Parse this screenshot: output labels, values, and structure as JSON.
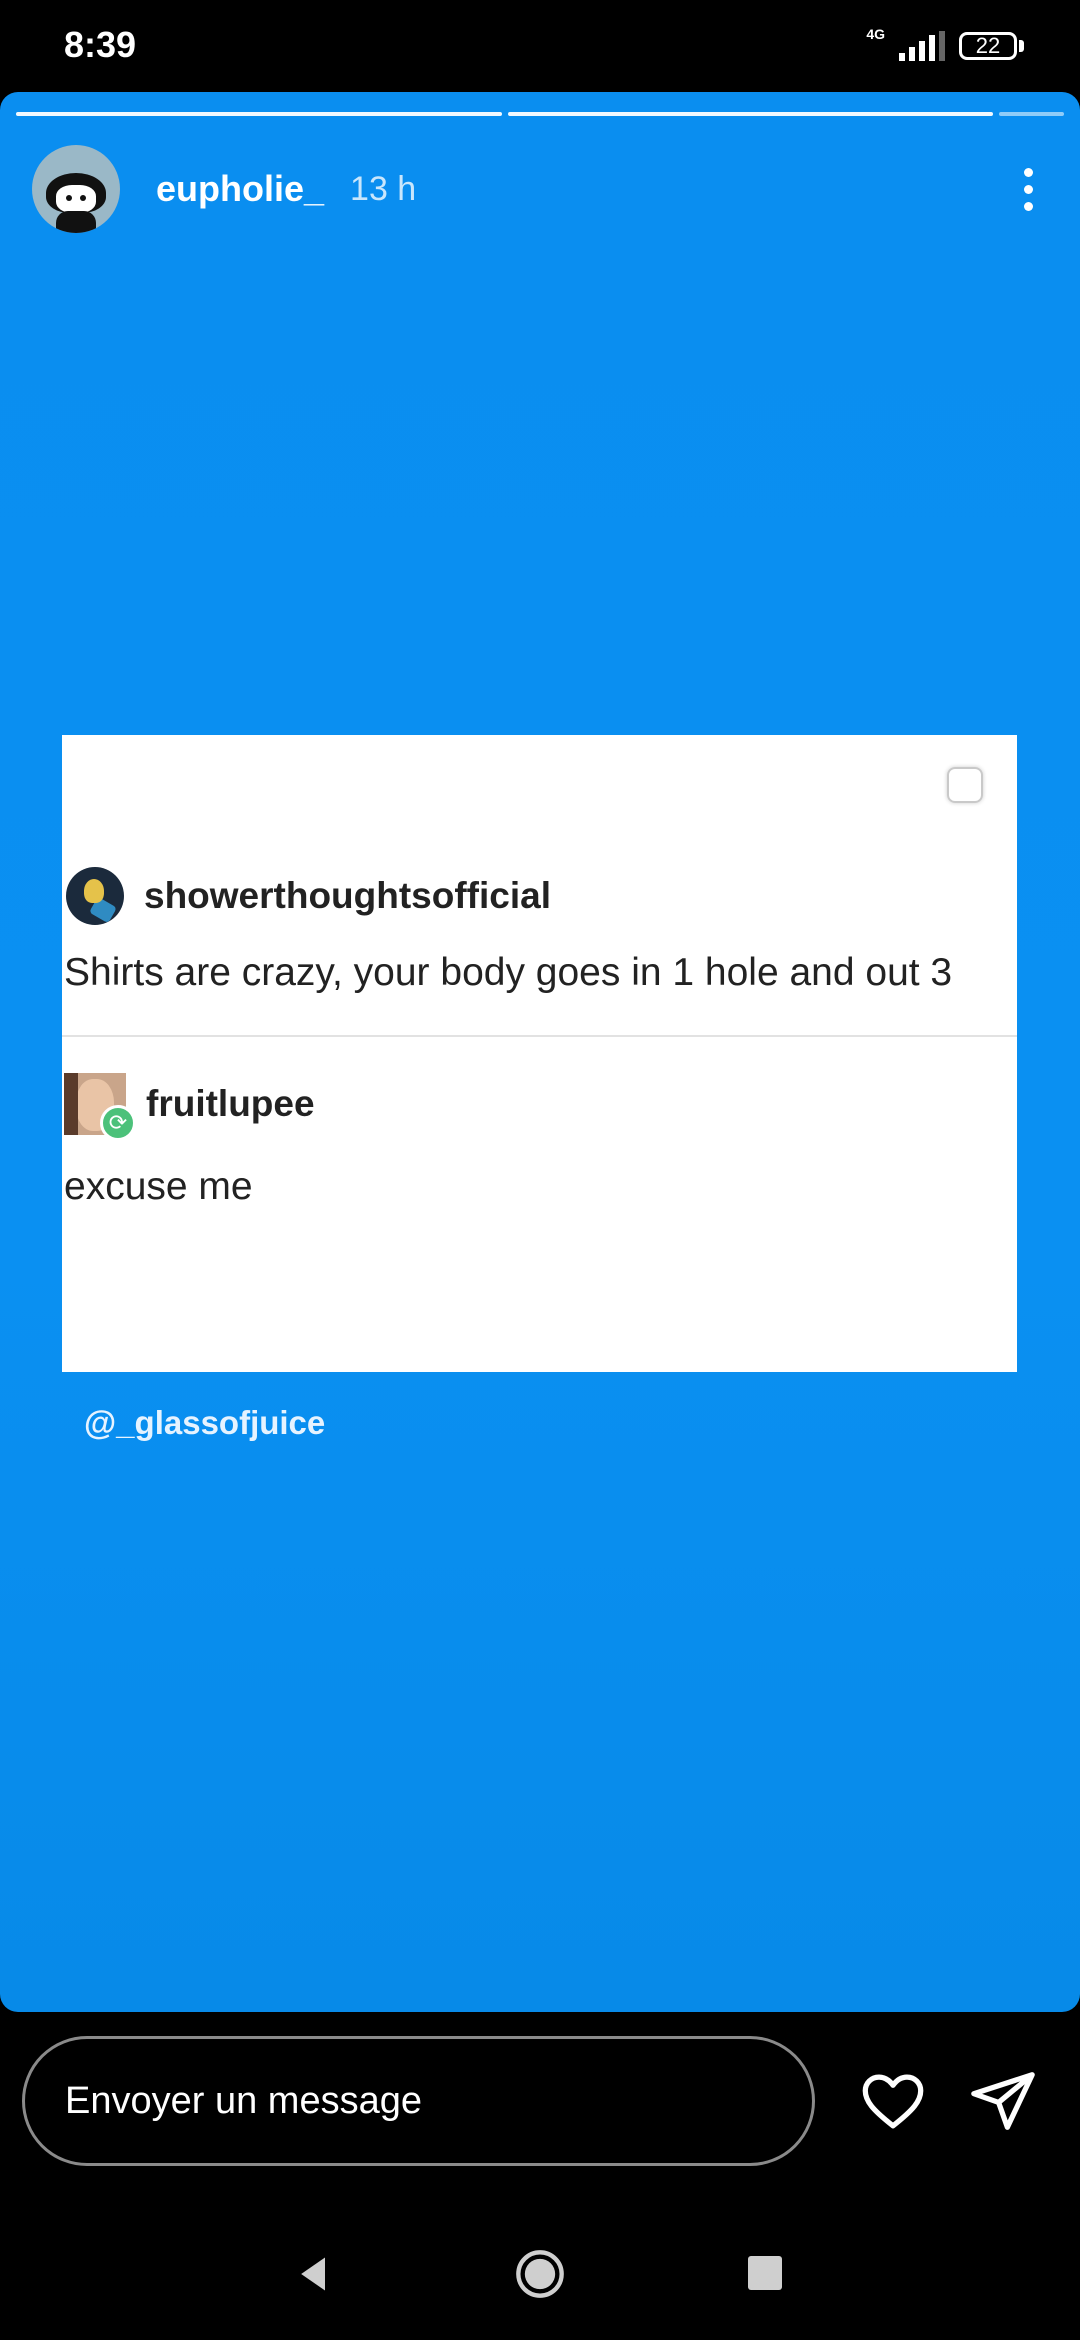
{
  "status_bar": {
    "time": "8:39",
    "network": "4G",
    "battery": "22"
  },
  "story": {
    "username": "eupholie_",
    "time_ago": "13 h",
    "background_color": "#0a8ef0",
    "post": {
      "original_user": "showerthoughtsofficial",
      "original_text": "Shirts are crazy, your body goes in 1 hole and out 3",
      "reply_user": "fruitlupee",
      "reply_text": "excuse me"
    },
    "mention": "@_glassofjuice"
  },
  "reply_bar": {
    "placeholder": "Envoyer un message",
    "icons": [
      "heart-icon",
      "send-icon"
    ]
  },
  "nav_bar": {
    "icons": [
      "back-icon",
      "home-icon",
      "recent-apps-icon"
    ]
  }
}
